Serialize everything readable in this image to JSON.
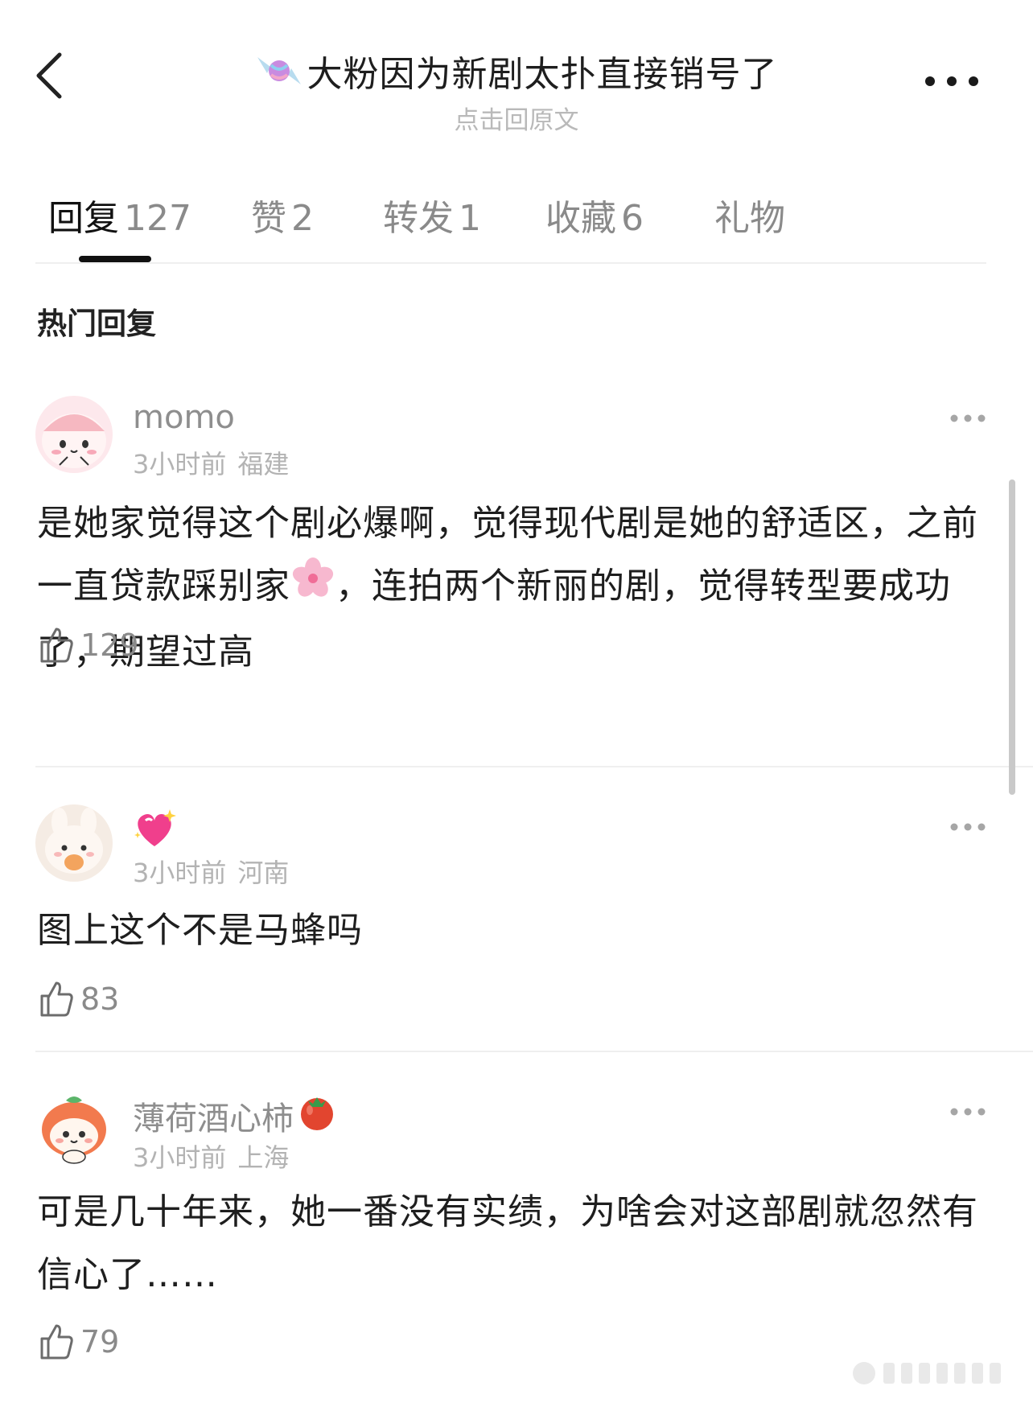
{
  "header": {
    "title": "大粉因为新剧太扑直接销号了",
    "title_icon": "candy-icon",
    "subtitle": "点击回原文",
    "back_icon": "chevron-left-icon",
    "more_icon": "more-dots-icon"
  },
  "tabs": [
    {
      "label": "回复",
      "count": "127",
      "active": true
    },
    {
      "label": "赞",
      "count": "2",
      "active": false
    },
    {
      "label": "转发",
      "count": "1",
      "active": false
    },
    {
      "label": "收藏",
      "count": "6",
      "active": false
    },
    {
      "label": "礼物",
      "count": "",
      "active": false
    }
  ],
  "section_title": "热门回复",
  "comments": [
    {
      "username": "momo",
      "time": "3小时前",
      "location": "福建",
      "body_parts": [
        "是她家觉得这个剧必爆啊，觉得现代剧是她的舒适区，之前一直贷款踩别家",
        "，连拍两个新丽的剧，觉得转型要成功了，期望过高"
      ],
      "body_emoji": "cherry-blossom-icon",
      "likes": "129",
      "avatar": "pink-mochi-avatar"
    },
    {
      "username": "",
      "username_icon": "sparkling-heart-icon",
      "time": "3小时前",
      "location": "河南",
      "body": "图上这个不是马蜂吗",
      "likes": "83",
      "avatar": "bunny-avatar"
    },
    {
      "username": "薄荷酒心柿",
      "username_icon": "tomato-icon",
      "time": "3小时前",
      "location": "上海",
      "body": "可是几十年来，她一番没有实绩，为啥会对这部剧就忽然有信心了……",
      "likes": "79",
      "avatar": "persimmon-avatar"
    }
  ],
  "colors": {
    "primary_text": "#1e1e1e",
    "secondary_text": "#8a8a8a",
    "muted_text": "#b3b3b3",
    "divider": "#efefef",
    "tab_indicator": "#111111"
  }
}
